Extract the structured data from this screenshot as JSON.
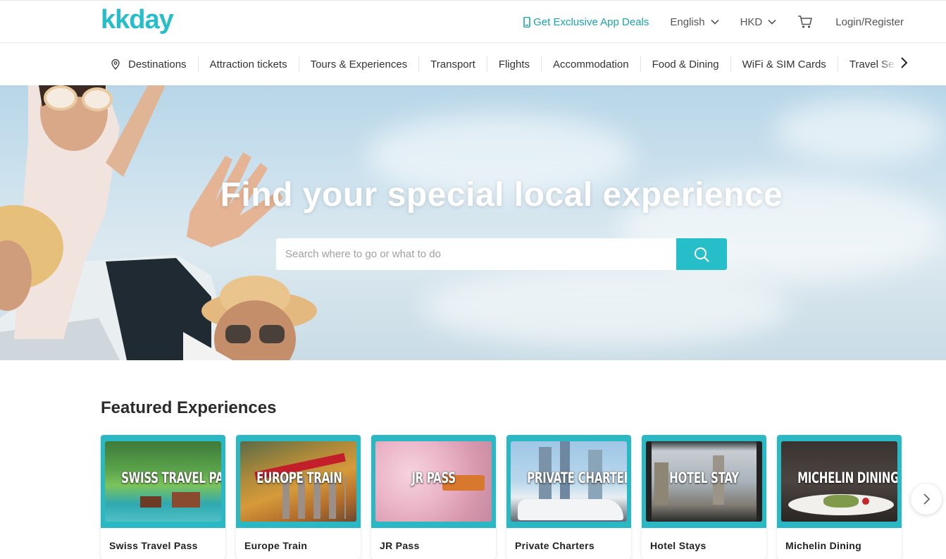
{
  "header": {
    "logo_text": "kkday",
    "app_deals": "Get Exclusive App Deals",
    "language": "English",
    "currency": "HKD",
    "login": "Login/Register"
  },
  "categories": [
    {
      "label": "Destinations",
      "icon": "location-pin-icon"
    },
    {
      "label": "Attraction tickets"
    },
    {
      "label": "Tours & Experiences"
    },
    {
      "label": "Transport"
    },
    {
      "label": "Flights"
    },
    {
      "label": "Accommodation"
    },
    {
      "label": "Food & Dining"
    },
    {
      "label": "WiFi & SIM Cards"
    },
    {
      "label": "Travel Se"
    }
  ],
  "hero": {
    "title": "Find your special local experience",
    "search_placeholder": "Search where to go or what to do"
  },
  "featured": {
    "title": "Featured Experiences",
    "cards": [
      {
        "image_label": "SWISS TRAVEL PASS",
        "name": "Swiss Travel Pass"
      },
      {
        "image_label": "EUROPE TRAIN",
        "name": "Europe Train"
      },
      {
        "image_label": "JR PASS",
        "name": "JR Pass"
      },
      {
        "image_label": "PRIVATE CHARTER",
        "name": "Private Charters"
      },
      {
        "image_label": "HOTEL STAY",
        "name": "Hotel Stays"
      },
      {
        "image_label": "MICHELIN DINING",
        "name": "Michelin Dining"
      }
    ]
  },
  "colors": {
    "brand": "#26bec9",
    "brand_dark": "#1aa3ad",
    "text": "#333333"
  }
}
